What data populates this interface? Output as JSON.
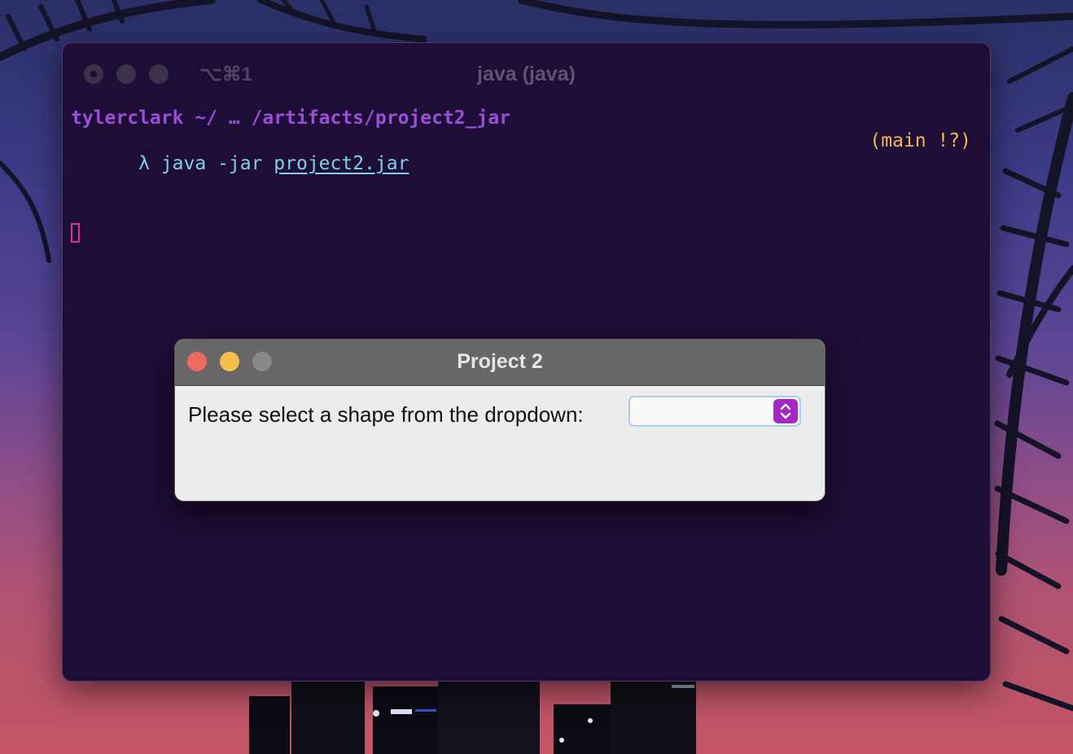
{
  "terminal": {
    "tab_shortcut": "⌥⌘1",
    "title": "java (java)",
    "prompt": "tylerclark ~/ … /artifacts/project2_jar",
    "lambda": "λ",
    "command": "java -jar",
    "argument": "project2.jar",
    "git_status": "(main !?)"
  },
  "dialog": {
    "title": "Project 2",
    "label": "Please select a shape from the dropdown:",
    "shape_dropdown": {
      "selected": ""
    }
  },
  "colors": {
    "terminal_bg": "#1e0d36",
    "prompt": "#9b4fd8",
    "command": "#7fd0f0",
    "git": "#f2b94a",
    "cursor": "#d9358c",
    "dropdown_accent": "#a528c4",
    "close": "#ec6a5e",
    "minimize": "#f4bf4f"
  }
}
